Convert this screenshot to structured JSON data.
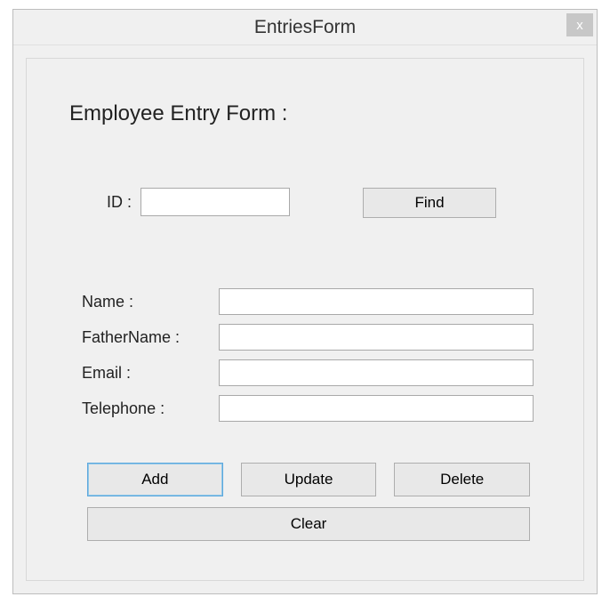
{
  "window": {
    "title": "EntriesForm",
    "close_glyph": "x"
  },
  "heading": "Employee Entry Form :",
  "id_section": {
    "label": "ID :",
    "value": "",
    "find_label": "Find"
  },
  "fields": [
    {
      "label": "Name :",
      "value": ""
    },
    {
      "label": "FatherName :",
      "value": ""
    },
    {
      "label": "Email :",
      "value": ""
    },
    {
      "label": "Telephone :",
      "value": ""
    }
  ],
  "buttons": {
    "add": "Add",
    "update": "Update",
    "delete": "Delete",
    "clear": "Clear"
  }
}
